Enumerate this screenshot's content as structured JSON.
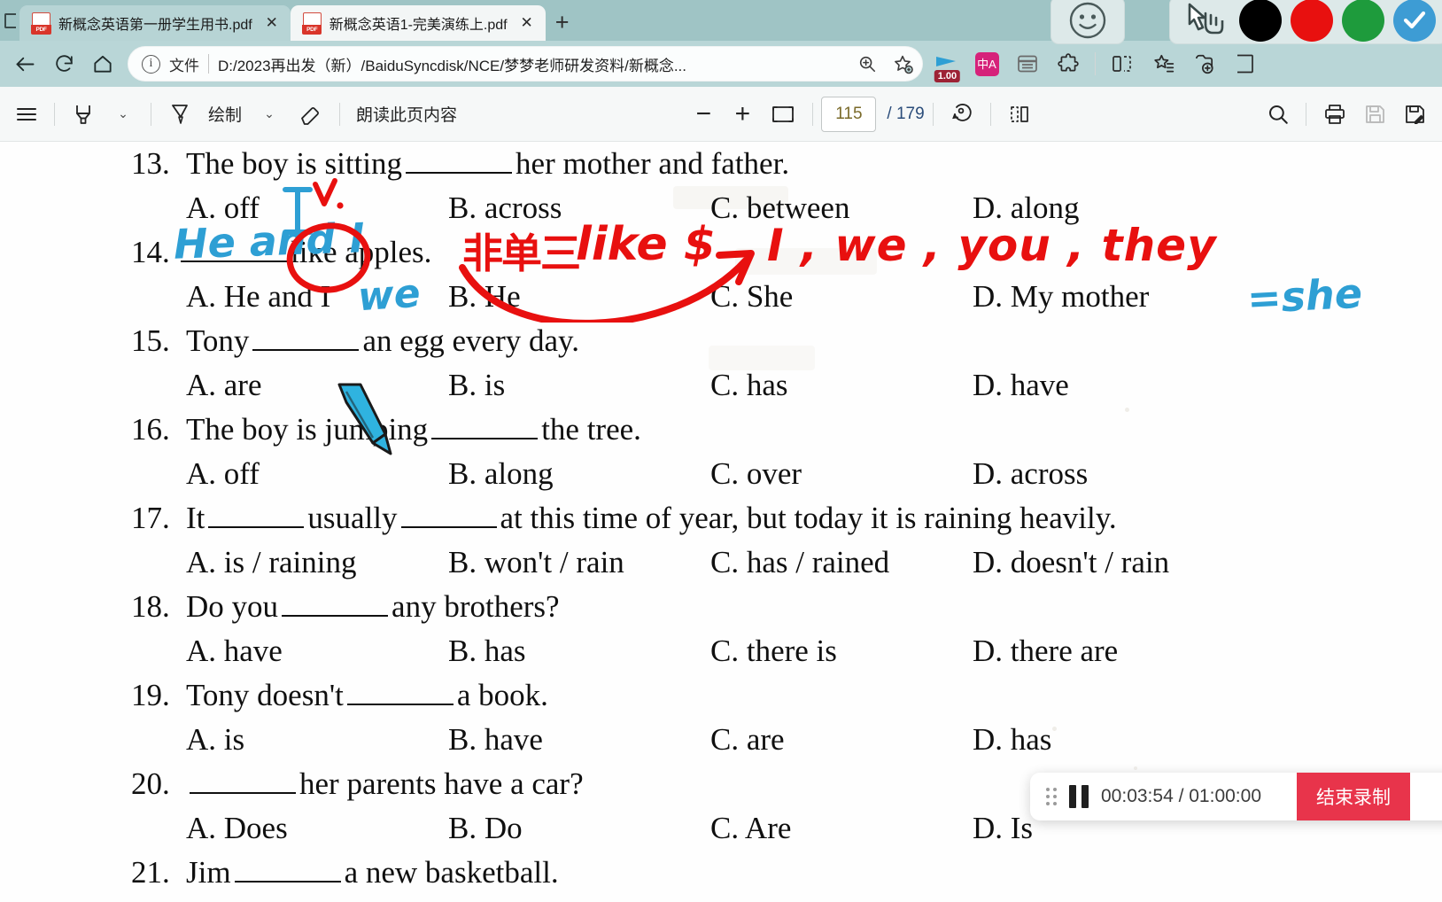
{
  "browser": {
    "tabs": [
      {
        "title": "新概念英语第一册学生用书.pdf",
        "icon": "pdf-icon",
        "active": false,
        "close_label": "✕"
      },
      {
        "title": "新概念英语1-完美演练上.pdf",
        "icon": "pdf-icon",
        "active": true,
        "close_label": "✕"
      }
    ],
    "new_tab_label": "+",
    "nav": {
      "back_icon": "back-arrow-icon",
      "reload_icon": "reload-icon",
      "home_icon": "home-icon"
    },
    "omnibox": {
      "info_glyph": "i",
      "scheme_label": "文件",
      "url": "D:/2023再出发（新）/BaiduSyncdisk/NCE/梦梦老师研发资料/新概念...",
      "zoom_icon": "zoom-in-icon",
      "favorite_icon": "add-favorite-icon"
    },
    "extensions": [
      {
        "name": "video-speed-controller-icon",
        "badge": "1.00"
      },
      {
        "name": "translate-icon",
        "label": "中A"
      },
      {
        "name": "reading-list-icon",
        "label": ""
      },
      {
        "name": "extensions-puzzle-icon",
        "label": ""
      },
      {
        "name": "split-screen-icon",
        "label": ""
      },
      {
        "name": "collections-icon",
        "label": ""
      },
      {
        "name": "add-collection-icon",
        "label": ""
      },
      {
        "name": "profile-icon",
        "label": ""
      }
    ]
  },
  "pdf_toolbar": {
    "menu_icon": "hamburger-menu-icon",
    "highlight_icon": "highlighter-icon",
    "highlight_chevron": "⌄",
    "draw_icon": "pen-draw-icon",
    "draw_label": "绘制",
    "draw_chevron": "⌄",
    "erase_icon": "eraser-icon",
    "read_aloud_label": "朗读此页内容",
    "zoom_out_label": "−",
    "zoom_in_label": "+",
    "fit_page_icon": "fit-page-icon",
    "current_page": "115",
    "page_total": "/ 179",
    "rotate_icon": "rotate-icon",
    "layout_icon": "page-layout-icon",
    "search_icon": "search-icon",
    "print_icon": "print-icon",
    "save_icon": "save-icon",
    "save_as_icon": "save-as-icon"
  },
  "annotation_toolbar": {
    "emoji_icon": "smiley-face-icon",
    "pointer_icon": "hand-pointer-icon",
    "colors": [
      {
        "name": "color-black",
        "hex": "#000000"
      },
      {
        "name": "color-red",
        "hex": "#e8100f"
      },
      {
        "name": "color-green",
        "hex": "#1e9b3c"
      }
    ],
    "confirm": {
      "name": "confirm-check-icon",
      "hex": "#3d9cd4",
      "glyph": "✓"
    }
  },
  "recording": {
    "drag_handle_icon": "drag-handle-icon",
    "pause_icon": "pause-icon",
    "elapsed": "00:03:54",
    "separator": "/",
    "total": "01:00:00",
    "time_display": "00:03:54 / 01:00:00",
    "stop_label": "结束录制",
    "stop_color": "#e8344b"
  },
  "document": {
    "questions": [
      {
        "num": "13.",
        "pre": "The boy is sitting",
        "post": "her mother and father.",
        "options": [
          "A. off",
          "B. across",
          "C. between",
          "D. along"
        ]
      },
      {
        "num": "14.",
        "pre": "",
        "post": "like apples.",
        "options": [
          "A. He and I",
          "B. He",
          "C. She",
          "D. My mother"
        ]
      },
      {
        "num": "15.",
        "pre": "Tony",
        "post": "an egg every day.",
        "options": [
          "A. are",
          "B. is",
          "C. has",
          "D. have"
        ]
      },
      {
        "num": "16.",
        "pre": "The boy is jumping",
        "post": "the tree.",
        "options": [
          "A. off",
          "B. along",
          "C. over",
          "D. across"
        ]
      },
      {
        "num": "17.",
        "pre": "It",
        "mid": "usually",
        "post": "at this time of year,  but today it is raining heavily.",
        "options": [
          "A. is / raining",
          "B. won't / rain",
          "C. has / rained",
          "D. doesn't / rain"
        ]
      },
      {
        "num": "18.",
        "pre": "Do you",
        "post": "any brothers?",
        "options": [
          "A. have",
          "B. has",
          "C. there is",
          "D. there are"
        ]
      },
      {
        "num": "19.",
        "pre": "Tony doesn't",
        "post": "a book.",
        "options": [
          "A. is",
          "B. have",
          "C. are",
          "D. has"
        ]
      },
      {
        "num": "20.",
        "pre": "",
        "post": "her parents have a car?",
        "options": [
          "A. Does",
          "B. Do",
          "C. Are",
          "D. Is"
        ]
      },
      {
        "num": "21.",
        "pre": "Jim",
        "post": "a new basketball.",
        "options": []
      }
    ],
    "annotations": [
      {
        "name": "ink-he-and-i",
        "text": "He and I",
        "color": "#2e9fd4",
        "kind": "handwriting-blue"
      },
      {
        "name": "ink-check-mark",
        "text": "v",
        "color": "#e8100f",
        "kind": "handwriting-red"
      },
      {
        "name": "ink-i-letter",
        "text": "I",
        "color": "#2e9fd4",
        "kind": "handwriting-blue"
      },
      {
        "name": "ink-circle-like",
        "text": "",
        "color": "#e8100f",
        "kind": "circle"
      },
      {
        "name": "ink-we",
        "text": "we",
        "color": "#2e9fd4",
        "kind": "handwriting-blue"
      },
      {
        "name": "ink-feidansan",
        "text": "非单三",
        "color": "#e8100f",
        "kind": "handwriting-red"
      },
      {
        "name": "ink-like-dollar",
        "text": "like $",
        "color": "#e8100f",
        "kind": "handwriting-red"
      },
      {
        "name": "ink-arrow-curve",
        "text": "",
        "color": "#e8100f",
        "kind": "arrow"
      },
      {
        "name": "ink-pronouns",
        "text": "I , we , you , they",
        "color": "#e8100f",
        "kind": "handwriting-red"
      },
      {
        "name": "ink-equals-she",
        "text": "=she",
        "color": "#2e9fd4",
        "kind": "handwriting-blue"
      }
    ]
  }
}
